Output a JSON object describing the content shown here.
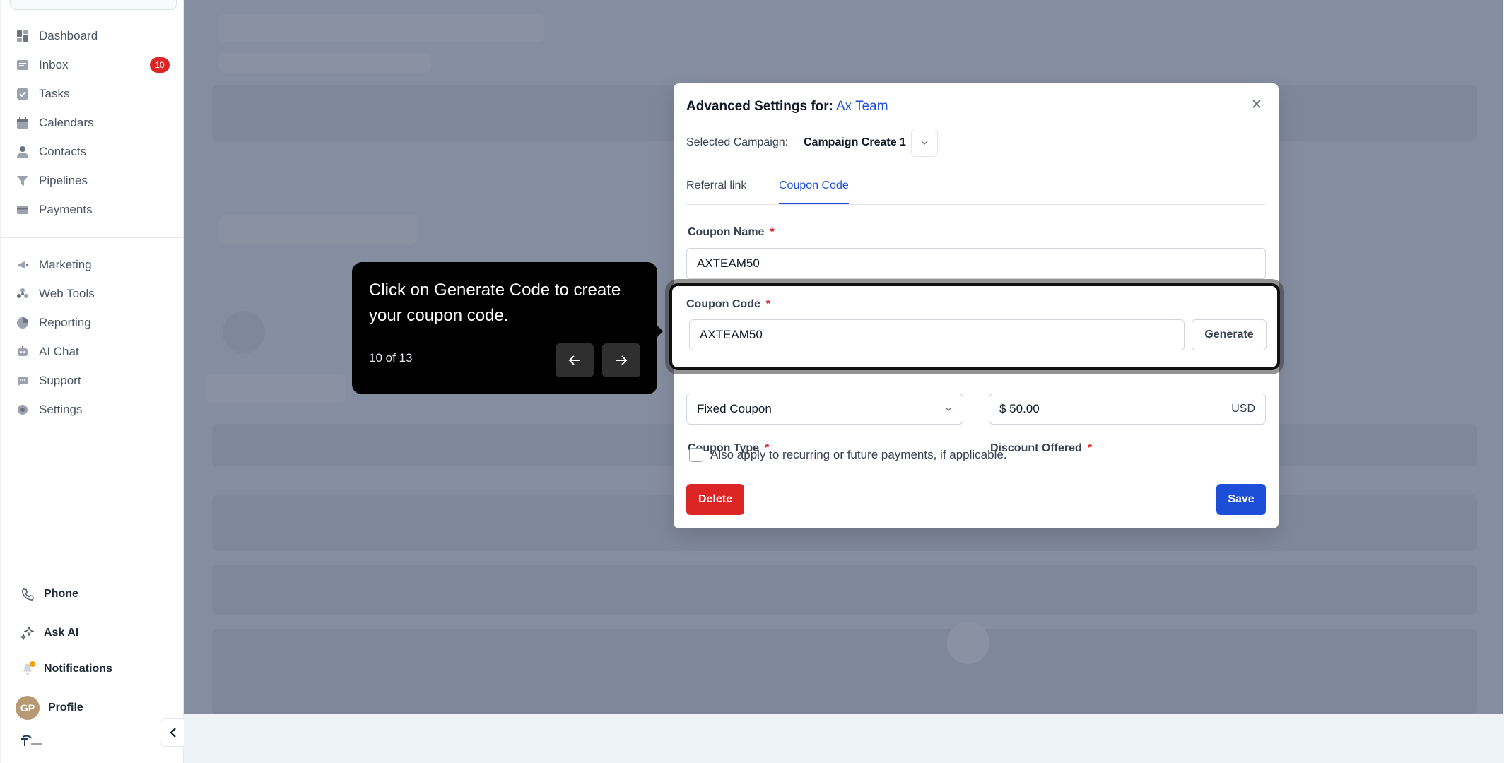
{
  "sidebar": {
    "items": [
      {
        "label": "Dashboard",
        "icon": "dashboard-icon"
      },
      {
        "label": "Inbox",
        "icon": "inbox-icon",
        "badge": "10"
      },
      {
        "label": "Tasks",
        "icon": "tasks-icon"
      },
      {
        "label": "Calendars",
        "icon": "calendar-icon"
      },
      {
        "label": "Contacts",
        "icon": "contacts-icon"
      },
      {
        "label": "Pipelines",
        "icon": "pipelines-icon"
      },
      {
        "label": "Payments",
        "icon": "payments-icon"
      },
      {
        "label": "Marketing",
        "icon": "marketing-icon"
      },
      {
        "label": "Web Tools",
        "icon": "web-tools-icon"
      },
      {
        "label": "Reporting",
        "icon": "reporting-icon"
      },
      {
        "label": "AI Chat",
        "icon": "ai-chat-icon"
      },
      {
        "label": "Support",
        "icon": "support-icon"
      },
      {
        "label": "Settings",
        "icon": "settings-icon"
      }
    ],
    "bottom": {
      "phone": "Phone",
      "ask_ai": "Ask AI",
      "notifications": "Notifications",
      "profile": "Profile",
      "avatar_initials": "GP"
    }
  },
  "modal": {
    "title": "Advanced Settings for:",
    "title_accent": "Ax Team",
    "campaign_label": "Selected Campaign:",
    "campaign_value": "Campaign Create 1",
    "tabs": [
      {
        "label": "Referral link",
        "active": false
      },
      {
        "label": "Coupon Code",
        "active": true
      }
    ],
    "coupon_name": {
      "label": "Coupon Name",
      "required": "*",
      "value": "AXTEAM50"
    },
    "coupon_code": {
      "label": "Coupon Code",
      "required": "*",
      "value": "AXTEAM50",
      "generate_label": "Generate"
    },
    "coupon_type": {
      "label": "Coupon Type",
      "required": "*",
      "value": "Fixed Coupon"
    },
    "discount": {
      "label": "Discount Offered",
      "required": "*",
      "value": "$ 50.00",
      "currency": "USD"
    },
    "recurring_label": "Also apply to recurring or future payments, if applicable.",
    "delete_label": "Delete",
    "save_label": "Save"
  },
  "tooltip": {
    "text": "Click on Generate Code to create your coupon code.",
    "step": "10 of 13"
  },
  "colors": {
    "accent": "#1d4ed8",
    "danger": "#dc2626",
    "badge": "#dc2626"
  }
}
